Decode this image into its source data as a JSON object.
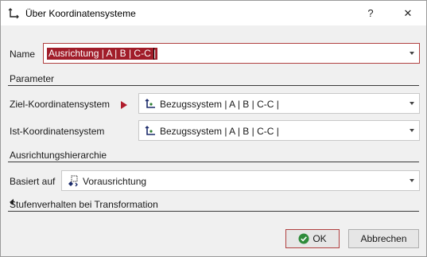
{
  "window": {
    "title": "Über Koordinatensysteme",
    "help_glyph": "?",
    "close_glyph": "✕"
  },
  "fields": {
    "name_label": "Name",
    "name_value": "Ausrichtung | A | B | C-C |",
    "parameter_section": "Parameter",
    "target_label": "Ziel-Koordinatensystem",
    "target_value": "Bezugssystem | A | B | C-C |",
    "actual_label": "Ist-Koordinatensystem",
    "actual_value": "Bezugssystem | A | B | C-C |",
    "hierarchy_section": "Ausrichtungshierarchie",
    "based_on_label": "Basiert auf",
    "based_on_value": "Vorausrichtung",
    "transform_section": "Stufenverhalten bei Transformation"
  },
  "buttons": {
    "ok": "OK",
    "cancel": "Abbrechen"
  },
  "colors": {
    "accent": "#a11d2a",
    "ok_icon": "#2e8b3a"
  },
  "icons": [
    "coordinate-system-icon",
    "help-icon",
    "close-icon",
    "chevron-down-icon",
    "red-marker-icon",
    "preliminary-alignment-icon",
    "checkmark-icon",
    "collapse-arrow-icon"
  ]
}
